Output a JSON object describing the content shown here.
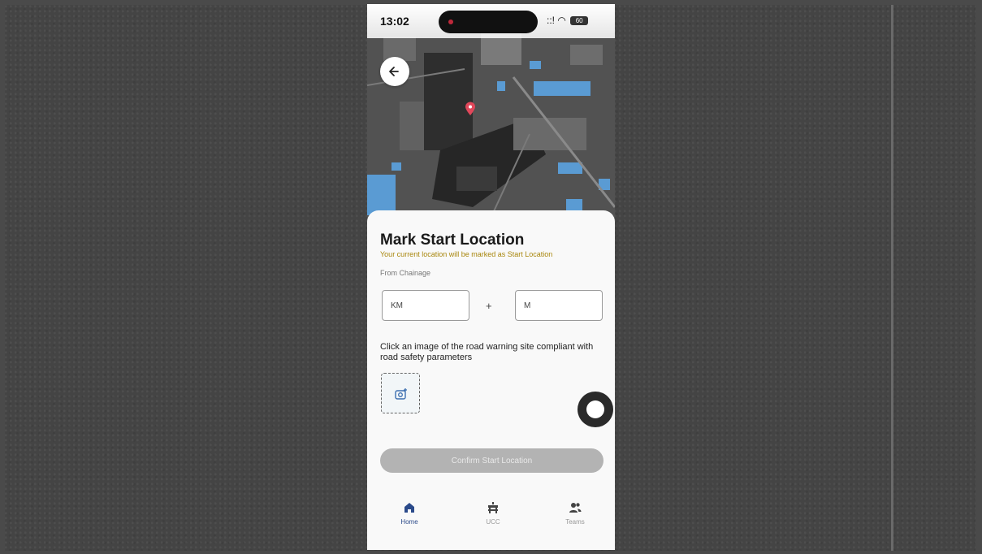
{
  "status_bar": {
    "time": "13:02",
    "signal": "::!",
    "battery": "60"
  },
  "map": {
    "back_icon": "arrow-left-icon",
    "pin_icon": "map-pin-icon",
    "pin_color": "#e0475a"
  },
  "sheet": {
    "title": "Mark Start Location",
    "subtitle": "Your current location will be marked as Start Location",
    "from_label": "From Chainage",
    "km_placeholder": "KM",
    "m_placeholder": "M",
    "plus": "+",
    "instruction": "Click an image of the road warning site compliant with road safety parameters",
    "photo_icon": "camera-add-icon",
    "confirm_label": "Confirm Start Location"
  },
  "nav": {
    "items": [
      {
        "label": "Home",
        "icon": "home-icon",
        "active": true
      },
      {
        "label": "UCC",
        "icon": "barrier-icon",
        "active": false
      },
      {
        "label": "Teams",
        "icon": "users-icon",
        "active": false
      }
    ]
  },
  "colors": {
    "accent": "#2b4a8a",
    "subtitle": "#a8860c",
    "button_disabled": "#b3b3b3"
  }
}
